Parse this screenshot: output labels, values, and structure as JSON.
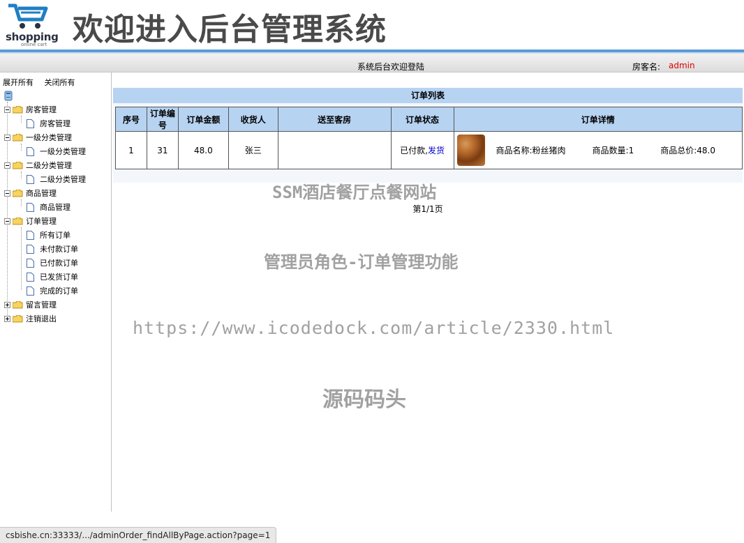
{
  "header": {
    "logo_word": "shopping",
    "logo_sub": "online cart",
    "title": "欢迎进入后台管理系统"
  },
  "topbar": {
    "welcome": "系统后台欢迎登陆",
    "user_label": "房客名:",
    "user_name": "admin"
  },
  "sidebar": {
    "expand_all": "展开所有",
    "collapse_all": "关闭所有",
    "groups": [
      {
        "label": "房客管理",
        "children": [
          "房客管理"
        ]
      },
      {
        "label": "一级分类管理",
        "children": [
          "一级分类管理"
        ]
      },
      {
        "label": "二级分类管理",
        "children": [
          "二级分类管理"
        ]
      },
      {
        "label": "商品管理",
        "children": [
          "商品管理"
        ]
      },
      {
        "label": "订单管理",
        "children": [
          "所有订单",
          "未付款订单",
          "已付款订单",
          "已发货订单",
          "完成的订单"
        ]
      },
      {
        "label": "留言管理",
        "children": []
      },
      {
        "label": "注销退出",
        "children": []
      }
    ]
  },
  "main": {
    "list_title": "订单列表",
    "columns": [
      "序号",
      "订单编号",
      "订单金额",
      "收货人",
      "送至客房",
      "订单状态",
      "订单详情"
    ],
    "rows": [
      {
        "index": "1",
        "order_no": "31",
        "amount": "48.0",
        "receiver": "张三",
        "room": "",
        "status_text": "已付款,",
        "status_action": "发货",
        "detail_name": "商品名称:粉丝猪肉",
        "detail_qty": "商品数量:1",
        "detail_total": "商品总价:48.0"
      }
    ],
    "pager": "第1/1页"
  },
  "watermarks": {
    "line1": "SSM酒店餐厅点餐网站",
    "line2": "管理员角色-订单管理功能",
    "line3": "https://www.icodedock.com/article/2330.html",
    "line4": "源码码头"
  },
  "browser_status": "csbishe.cn:33333/.../adminOrder_findAllByPage.action?page=1",
  "colors": {
    "header_rule": "#5b9bd5",
    "table_header": "#b7d3f2",
    "user_name": "#e00000",
    "link": "#0000cc"
  }
}
